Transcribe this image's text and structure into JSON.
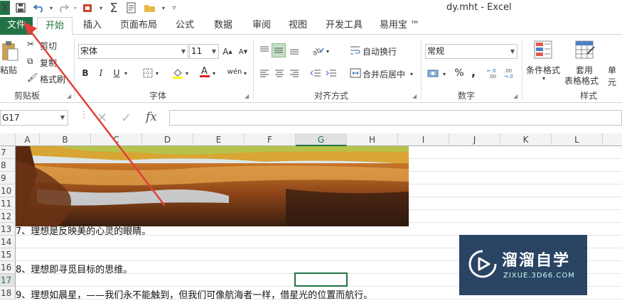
{
  "window": {
    "title": "dy.mht - Excel"
  },
  "qat": {
    "app_icon": "X"
  },
  "tabs": [
    {
      "label": "文件"
    },
    {
      "label": "开始"
    },
    {
      "label": "插入"
    },
    {
      "label": "页面布局"
    },
    {
      "label": "公式"
    },
    {
      "label": "数据"
    },
    {
      "label": "审阅"
    },
    {
      "label": "视图"
    },
    {
      "label": "开发工具"
    },
    {
      "label": "易用宝 ™"
    }
  ],
  "ribbon": {
    "clipboard": {
      "paste": "粘贴",
      "cut": "剪切",
      "copy": "复制",
      "format_painter": "格式刷",
      "label": "剪贴板"
    },
    "font": {
      "name": "宋体",
      "size": "11",
      "bold": "B",
      "italic": "I",
      "underline": "U",
      "wen": "wén",
      "label": "字体"
    },
    "alignment": {
      "wrap": "自动换行",
      "merge": "合并后居中",
      "label": "对齐方式"
    },
    "number": {
      "format": "常规",
      "percent": "%",
      "comma": ",",
      "label": "数字"
    },
    "styles": {
      "conditional": "条件格式",
      "table_fmt_1": "套用",
      "table_fmt_2": "表格格式",
      "cell": "单元",
      "label": "样式"
    }
  },
  "formula_bar": {
    "name_box": "G17",
    "fx": "fx",
    "value": ""
  },
  "columns": [
    "A",
    "B",
    "C",
    "D",
    "E",
    "F",
    "G",
    "H",
    "I",
    "J",
    "K",
    "L"
  ],
  "selected_column": "G",
  "rows": [
    "7",
    "8",
    "9",
    "10",
    "11",
    "12",
    "13",
    "14",
    "15",
    "16",
    "17",
    "18"
  ],
  "selected_row": "17",
  "cells": {
    "r13": "7、理想是反映美的心灵的眼睛。",
    "r16": "8、理想即寻觅目标的思维。",
    "r18": "9、理想如晨星，——我们永不能触到，但我们可像航海者一样，借星光的位置而航行。"
  },
  "watermark": {
    "title": "溜溜自学",
    "subtitle": "ZIXUE.3D66.COM"
  },
  "colors": {
    "accent": "#217346",
    "arrow": "#e0413b"
  }
}
